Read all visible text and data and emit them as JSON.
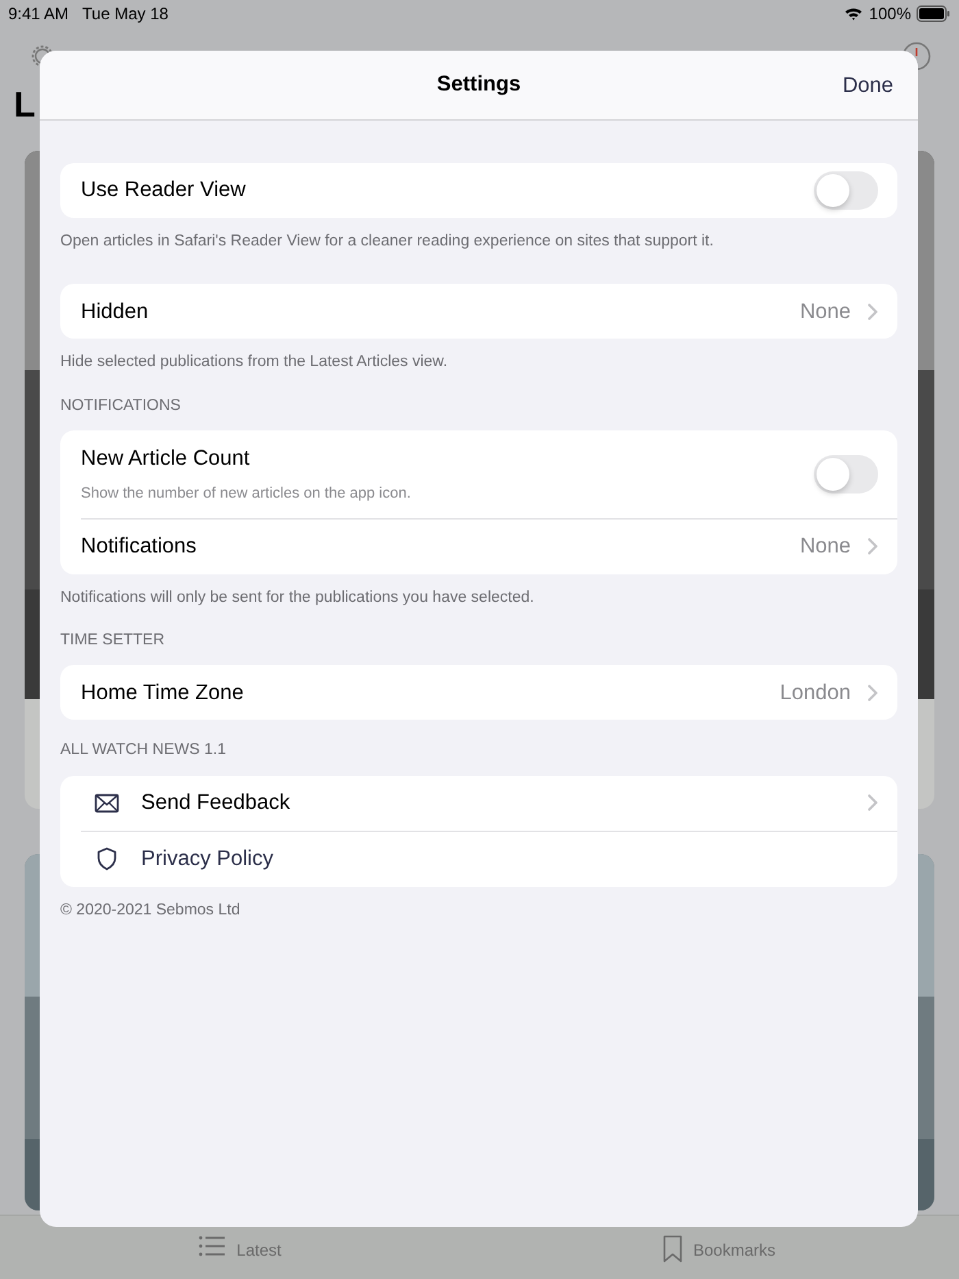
{
  "status_bar": {
    "time": "9:41 AM",
    "date": "Tue May 18",
    "battery": "100%"
  },
  "background": {
    "title": "L",
    "tabs": [
      {
        "label": "Latest"
      },
      {
        "label": "Bookmarks"
      }
    ]
  },
  "settings": {
    "title": "Settings",
    "done_button": "Done",
    "sections": [
      {
        "rows": [
          {
            "kind": "toggle",
            "label": "Use Reader View",
            "on": false
          }
        ],
        "footer": "Open articles in Safari's Reader View for a cleaner reading experience on sites that support it."
      },
      {
        "rows": [
          {
            "kind": "value",
            "label": "Hidden",
            "value": "None"
          }
        ],
        "footer": "Hide selected publications from the Latest Articles view."
      },
      {
        "header": "NOTIFICATIONS",
        "rows": [
          {
            "kind": "toggle",
            "label": "New Article Count",
            "subtitle": "Show the number of new articles on the app icon.",
            "on": false
          },
          {
            "kind": "value",
            "label": "Notifications",
            "value": "None"
          }
        ],
        "footer": "Notifications will only be sent for the publications you have selected."
      },
      {
        "header": "TIME SETTER",
        "rows": [
          {
            "kind": "value",
            "label": "Home Time Zone",
            "value": "London"
          }
        ]
      },
      {
        "header": "ALL WATCH NEWS 1.1",
        "rows": [
          {
            "kind": "nav",
            "label": "Send Feedback"
          },
          {
            "kind": "link",
            "label": "Privacy Policy"
          }
        ],
        "footer": "© 2020-2021 Sebmos Ltd"
      }
    ]
  }
}
